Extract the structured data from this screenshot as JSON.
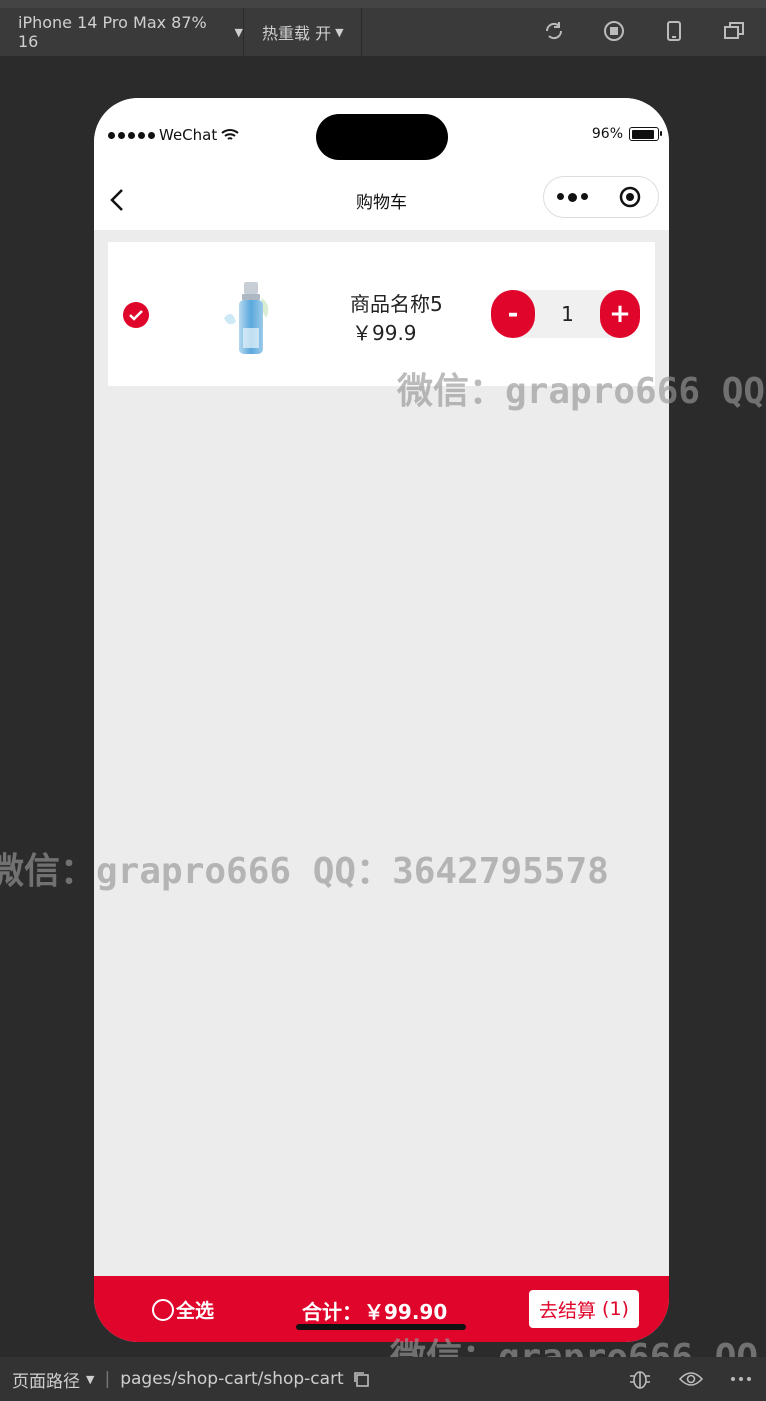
{
  "simulator": {
    "device_label": "iPhone 14 Pro Max 87% 16",
    "hot_reload_label": "热重载 开"
  },
  "status_bar": {
    "carrier": "WeChat",
    "battery": "96%"
  },
  "navbar": {
    "title": "购物车"
  },
  "cart": {
    "items": [
      {
        "name": "商品名称5",
        "price": "￥99.9",
        "quantity": "1",
        "selected": true
      }
    ]
  },
  "stepper": {
    "minus": "-",
    "plus": "+"
  },
  "bottom_bar": {
    "select_all_label": "全选",
    "total_label": "合计：",
    "total_value": "￥99.90",
    "checkout_label": "去结算",
    "checkout_count": "(1)"
  },
  "path_bar": {
    "label": "页面路径",
    "path": "pages/shop-cart/shop-cart"
  },
  "watermark": {
    "line1": "微信：grapro666 QQ",
    "line2": "微信：grapro666 QQ：3642795578",
    "line3": "微信：grapro666 QQ"
  },
  "colors": {
    "accent": "#e0052a",
    "page_bg": "#ececec",
    "frame_bg": "#2b2b2b"
  }
}
